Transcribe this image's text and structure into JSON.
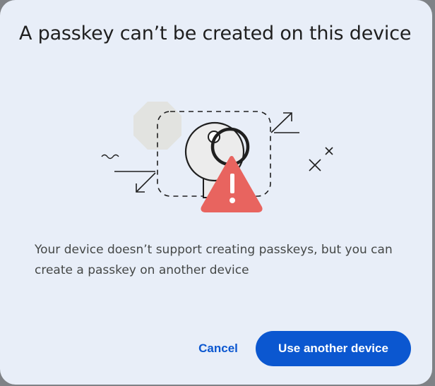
{
  "dialog": {
    "title": "A passkey can’t be created on this device",
    "message": "Your device doesn’t support creating passkeys, but you can create a passkey on another device",
    "illustration": {
      "icon_names": [
        "octagon-shape",
        "key-icon",
        "warning-icon",
        "arrow-icon",
        "sparkle-icon"
      ],
      "warning_color": "#e8645f",
      "octagon_color": "#e2e3e0",
      "key_fill_color": "#ececec"
    },
    "actions": {
      "cancel_label": "Cancel",
      "primary_label": "Use another device"
    }
  },
  "colors": {
    "accent": "#0b57d0",
    "surface": "#e8eef8",
    "title_text": "#1f1f1f",
    "body_text": "#444746"
  }
}
